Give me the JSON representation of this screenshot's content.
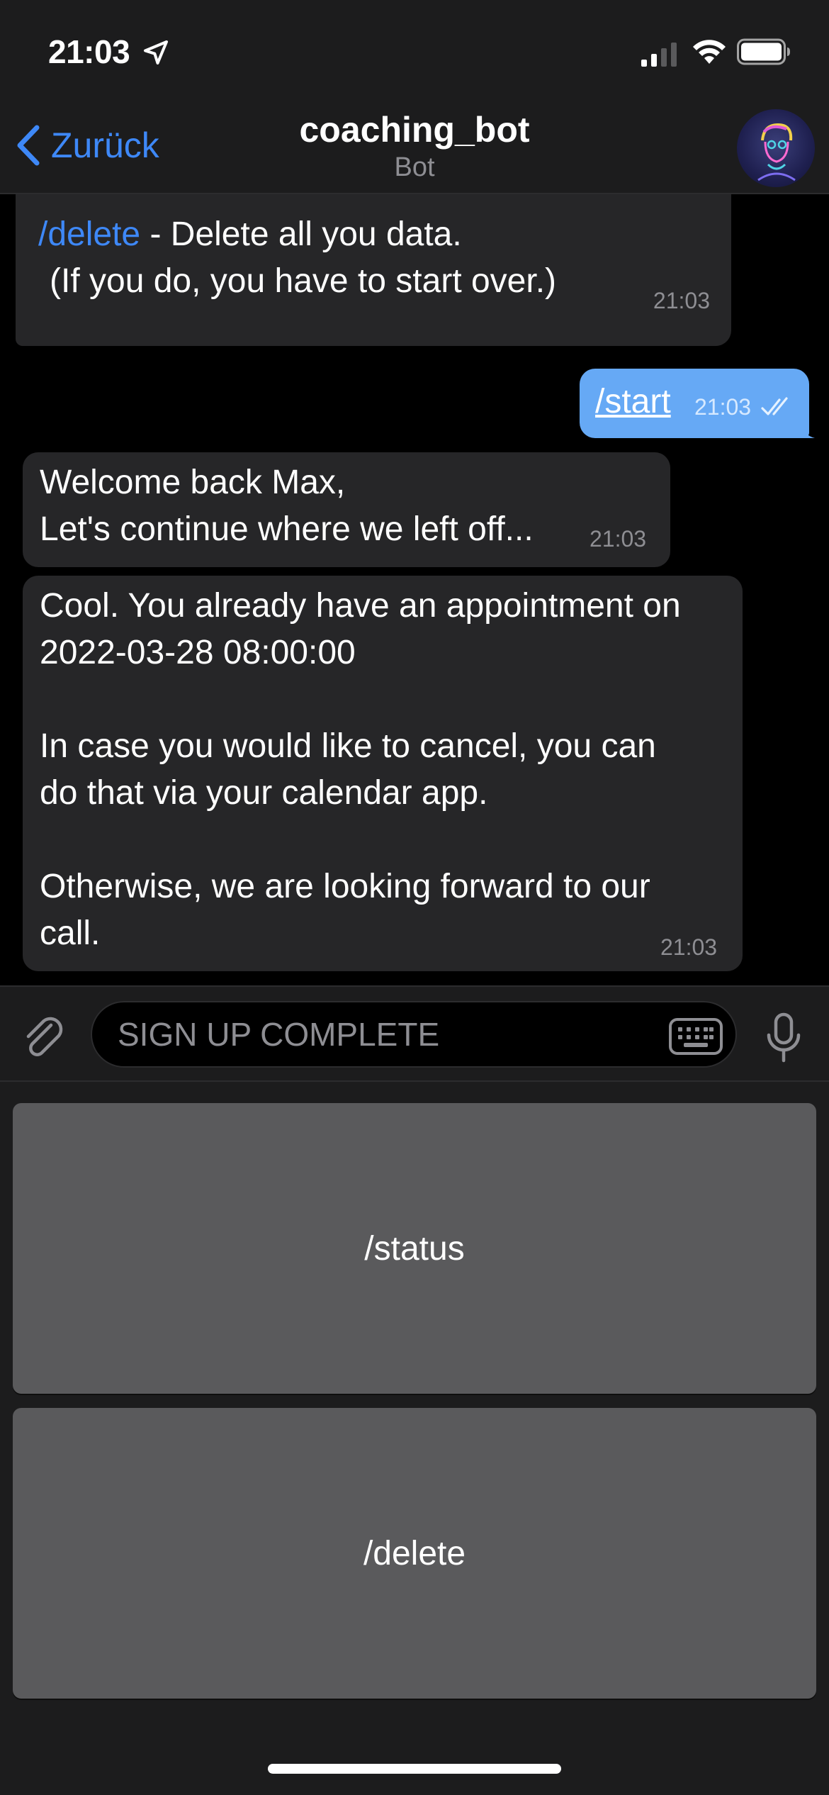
{
  "status_bar": {
    "time": "21:03"
  },
  "header": {
    "back_label": "Zurück",
    "title": "coaching_bot",
    "subtitle": "Bot"
  },
  "messages": [
    {
      "direction": "incoming",
      "command": "/delete",
      "text_after_command": " - Delete all you data.",
      "line2": "(If you do, you have to start over.)",
      "time": "21:03"
    },
    {
      "direction": "outgoing",
      "text": "/start",
      "time": "21:03",
      "status": "read"
    },
    {
      "direction": "incoming",
      "lines": [
        "Welcome back Max,",
        "Let's continue where we left off..."
      ],
      "time": "21:03"
    },
    {
      "direction": "incoming",
      "lines": [
        "Cool. You already have an appointment on",
        "2022-03-28 08:00:00",
        "In case you would like to cancel, you can",
        "do that via your calendar app.",
        "Otherwise, we are looking forward to our",
        "call."
      ],
      "time": "21:03"
    }
  ],
  "input_bar": {
    "placeholder": "SIGN UP COMPLETE"
  },
  "keyboard": {
    "buttons": [
      "/status",
      "/delete"
    ]
  },
  "colors": {
    "accent": "#3e88f7",
    "outgoing_bubble": "#66a9f5",
    "incoming_bubble": "#262628",
    "button": "#5a5a5c"
  }
}
